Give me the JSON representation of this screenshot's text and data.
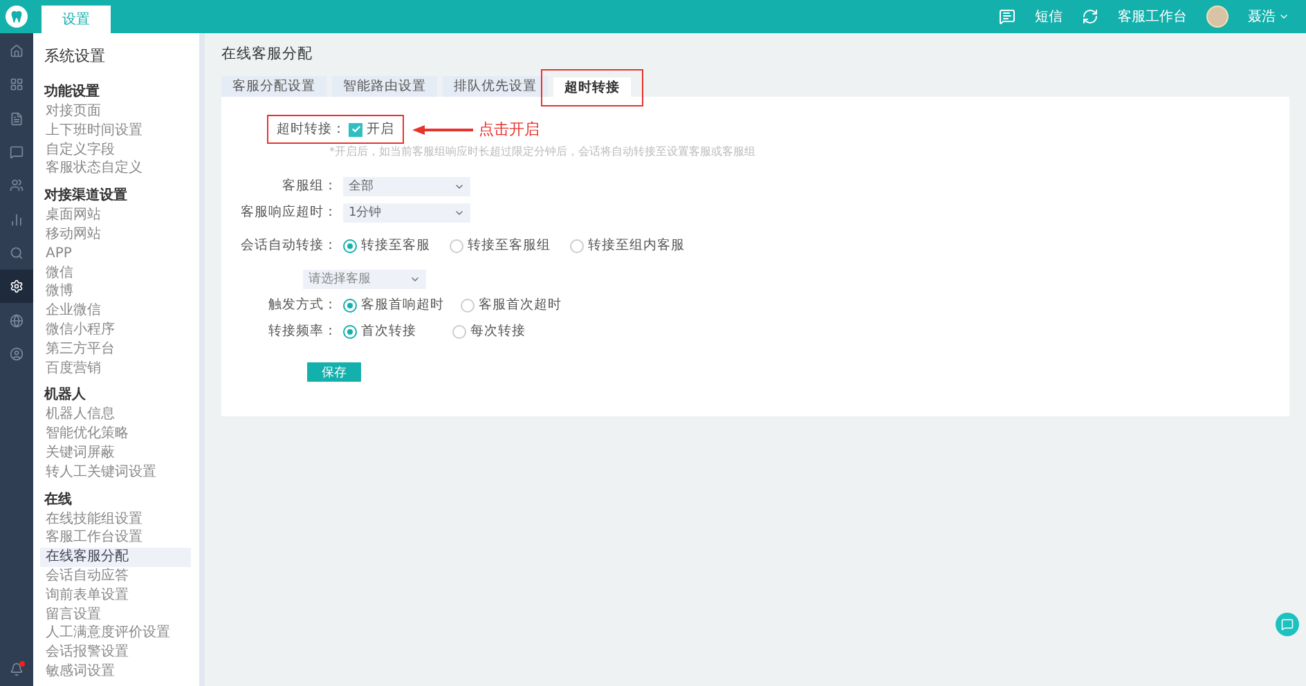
{
  "topbar": {
    "tabs": [
      {
        "label": "设置",
        "selected": true
      }
    ],
    "actions": [
      {
        "kind": "sms",
        "label": "短信"
      },
      {
        "kind": "workbench",
        "label": "客服工作台"
      }
    ],
    "user": {
      "name": "聂浩"
    }
  },
  "rail": {
    "items": [
      {
        "kind": "home",
        "selected": false
      },
      {
        "kind": "grid",
        "selected": false
      },
      {
        "kind": "doc",
        "selected": false
      },
      {
        "kind": "chat",
        "selected": false
      },
      {
        "kind": "users",
        "selected": false
      },
      {
        "kind": "chart",
        "selected": false
      },
      {
        "kind": "search",
        "selected": false
      },
      {
        "kind": "settings",
        "selected": true
      },
      {
        "kind": "globe",
        "selected": false
      },
      {
        "kind": "user",
        "selected": false
      }
    ],
    "notification": {
      "unread": true
    }
  },
  "sidebar": {
    "title": "系统设置",
    "groups": [
      {
        "title": "功能设置",
        "items": [
          {
            "label": "对接页面",
            "selected": false
          },
          {
            "label": "上下班时间设置",
            "selected": false
          },
          {
            "label": "自定义字段",
            "selected": false
          },
          {
            "label": "客服状态自定义",
            "selected": false
          }
        ]
      },
      {
        "title": "对接渠道设置",
        "items": [
          {
            "label": "桌面网站",
            "selected": false
          },
          {
            "label": "移动网站",
            "selected": false
          },
          {
            "label": "APP",
            "selected": false
          },
          {
            "label": "微信",
            "selected": false
          },
          {
            "label": "微博",
            "selected": false
          },
          {
            "label": "企业微信",
            "selected": false
          },
          {
            "label": "微信小程序",
            "selected": false
          },
          {
            "label": "第三方平台",
            "selected": false
          },
          {
            "label": "百度营销",
            "selected": false
          }
        ]
      },
      {
        "title": "机器人",
        "items": [
          {
            "label": "机器人信息",
            "selected": false
          },
          {
            "label": "智能优化策略",
            "selected": false
          },
          {
            "label": "关键词屏蔽",
            "selected": false
          },
          {
            "label": "转人工关键词设置",
            "selected": false
          }
        ]
      },
      {
        "title": "在线",
        "items": [
          {
            "label": "在线技能组设置",
            "selected": false
          },
          {
            "label": "客服工作台设置",
            "selected": false
          },
          {
            "label": "在线客服分配",
            "selected": true
          },
          {
            "label": "会话自动应答",
            "selected": false
          },
          {
            "label": "询前表单设置",
            "selected": false
          },
          {
            "label": "留言设置",
            "selected": false
          },
          {
            "label": "人工满意度评价设置",
            "selected": false
          },
          {
            "label": "会话报警设置",
            "selected": false
          },
          {
            "label": "敏感词设置",
            "selected": false
          }
        ]
      }
    ]
  },
  "content": {
    "title": "在线客服分配",
    "tabs": [
      {
        "label": "客服分配设置",
        "selected": false,
        "highlighted": false
      },
      {
        "label": "智能路由设置",
        "selected": false,
        "highlighted": false
      },
      {
        "label": "排队优先设置",
        "selected": false,
        "highlighted": false
      },
      {
        "label": "超时转接",
        "selected": true,
        "highlighted": true
      }
    ],
    "timeout_switch": {
      "label": "超时转接：",
      "option": "开启",
      "checked": true,
      "highlighted": true
    },
    "hint": "*开启后，如当前客服组响应时长超过限定分钟后，会话将自动转接至设置客服或客服组",
    "selects": [
      {
        "label": "客服组：",
        "value": "全部"
      },
      {
        "label": "客服响应超时：",
        "value": "1分钟"
      }
    ],
    "auto_transfer": {
      "label": "会话自动转接：",
      "options": [
        {
          "label": "转接至客服",
          "selected": true
        },
        {
          "label": "转接至客服组",
          "selected": false
        },
        {
          "label": "转接至组内客服",
          "selected": false
        }
      ]
    },
    "agent_select": {
      "placeholder": "请选择客服"
    },
    "trigger": {
      "label": "触发方式：",
      "options": [
        {
          "label": "客服首响超时",
          "selected": true
        },
        {
          "label": "客服首次超时",
          "selected": false
        }
      ]
    },
    "frequency": {
      "label": "转接频率：",
      "options": [
        {
          "label": "首次转接",
          "selected": true
        },
        {
          "label": "每次转接",
          "selected": false
        }
      ]
    },
    "save_button": "保存"
  },
  "annotation": {
    "label": "点击开启"
  }
}
